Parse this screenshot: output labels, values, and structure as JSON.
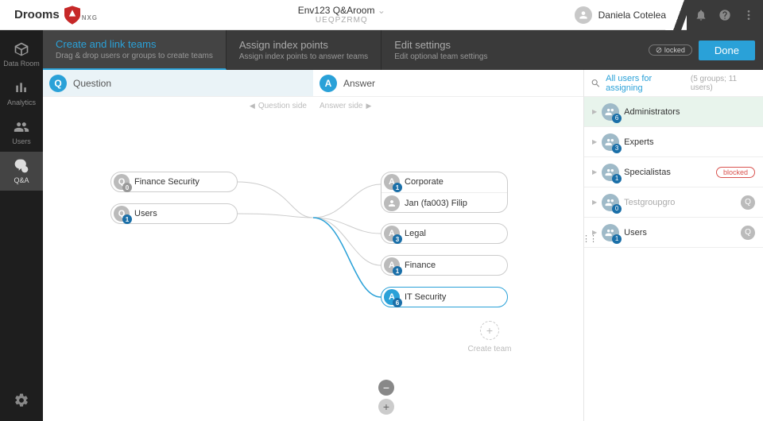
{
  "logo": {
    "brand": "Drooms",
    "sub": "NXG"
  },
  "room": {
    "name": "Env123 Q&Aroom",
    "code": "UEQPZRMQ"
  },
  "user": {
    "name": "Daniela Cotelea"
  },
  "sidenav": {
    "items": [
      {
        "label": "Data Room"
      },
      {
        "label": "Analytics"
      },
      {
        "label": "Users"
      },
      {
        "label": "Q&A"
      }
    ]
  },
  "tabs": [
    {
      "title": "Create and link teams",
      "sub": "Drag & drop users or groups to create teams"
    },
    {
      "title": "Assign index points",
      "sub": "Assign index points to answer teams"
    },
    {
      "title": "Edit settings",
      "sub": "Edit optional team settings"
    }
  ],
  "locked_label": "locked",
  "done_label": "Done",
  "columns": {
    "q": "Question",
    "a": "Answer"
  },
  "sidehints": {
    "q": "Question side",
    "a": "Answer side"
  },
  "question_teams": [
    {
      "name": "Finance Security",
      "count": 0
    },
    {
      "name": "Users",
      "count": 1
    }
  ],
  "answer_teams": [
    {
      "name": "Corporate",
      "count": 1,
      "person": "Jan (fa003) Filip"
    },
    {
      "name": "Legal",
      "count": 3
    },
    {
      "name": "Finance",
      "count": 1
    },
    {
      "name": "IT Security",
      "count": 6,
      "selected": true
    }
  ],
  "create_team_label": "Create team",
  "panel": {
    "title": "All users for assigning",
    "meta": "(5 groups; 11 users)",
    "groups": [
      {
        "name": "Administrators",
        "count": 6,
        "highlight": true
      },
      {
        "name": "Experts",
        "count": 3
      },
      {
        "name": "Specialistas",
        "count": 1,
        "blocked": true
      },
      {
        "name": "Testgroupgro",
        "count": 0,
        "q": true
      },
      {
        "name": "Users",
        "count": 1,
        "q": true
      }
    ],
    "blocked_label": "blocked"
  }
}
